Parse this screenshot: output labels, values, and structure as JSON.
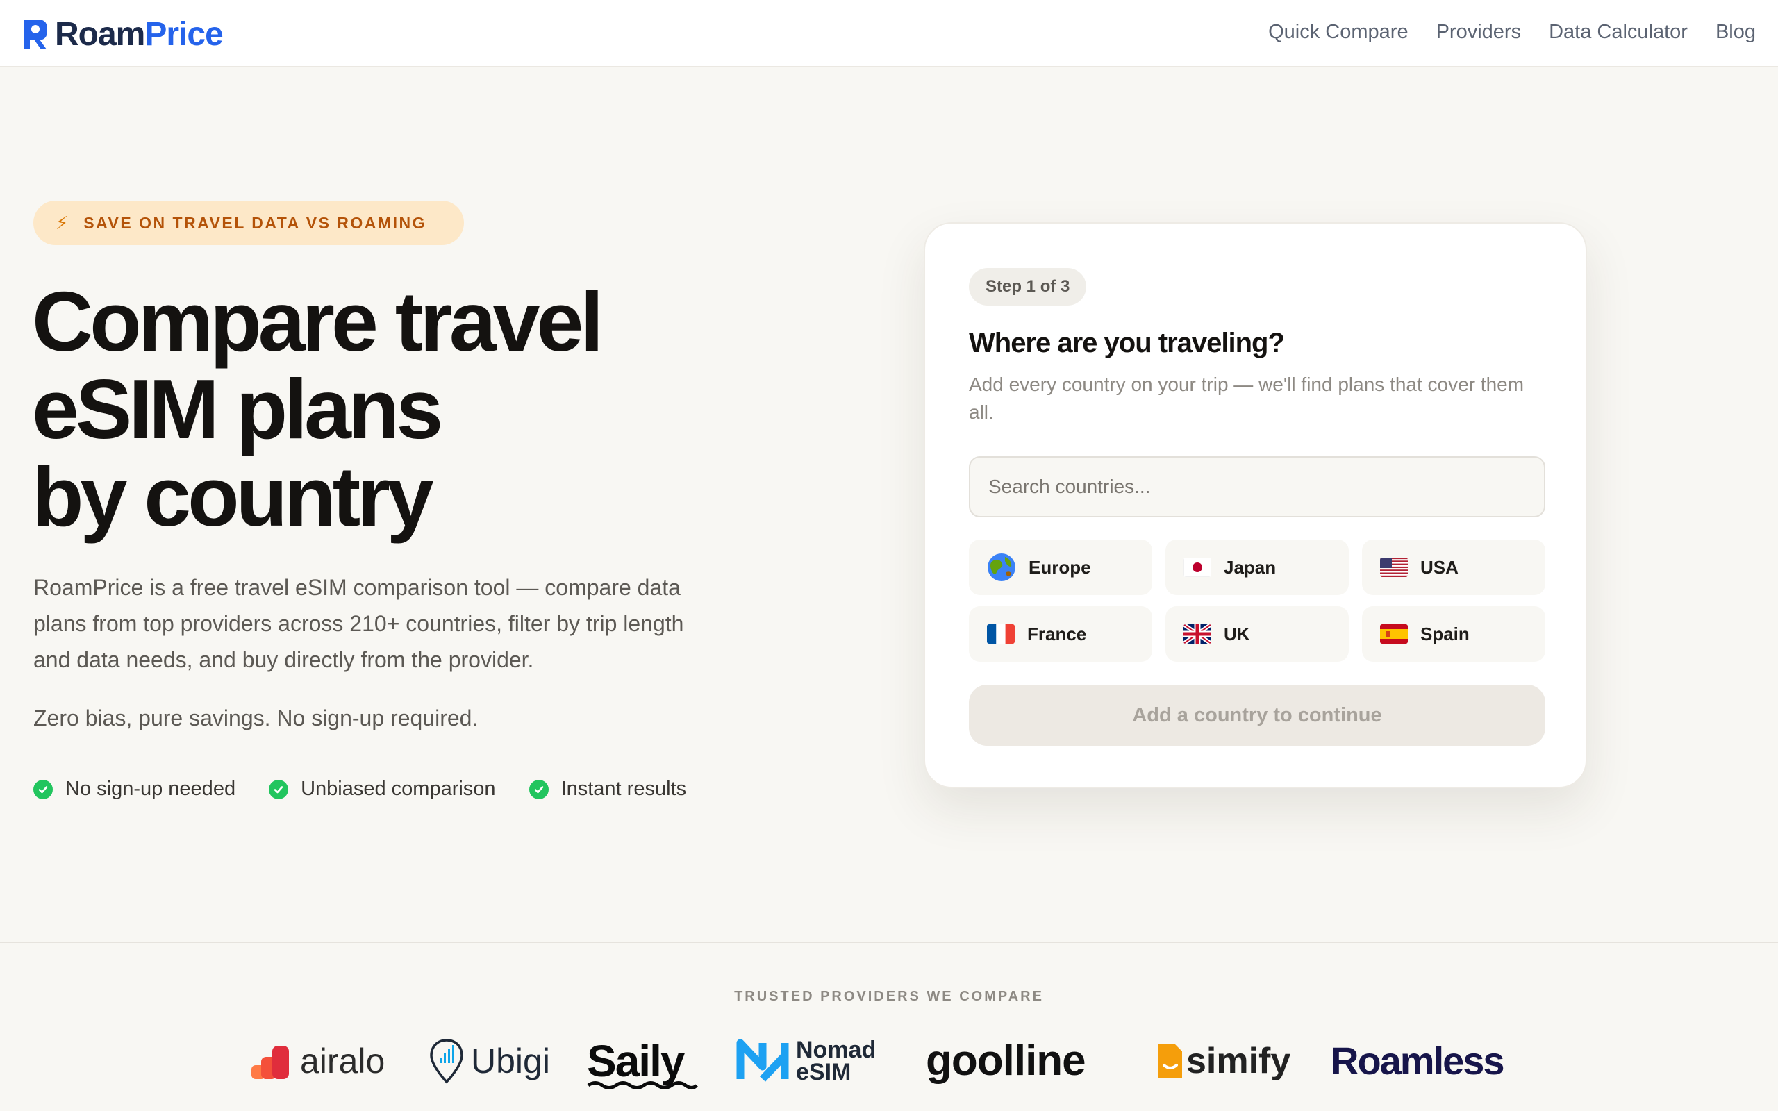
{
  "brand": {
    "name_part1": "Roam",
    "name_part2": "Price"
  },
  "nav": {
    "items": [
      "Quick Compare",
      "Providers",
      "Data Calculator",
      "Blog"
    ]
  },
  "hero": {
    "badge": "SAVE ON TRAVEL DATA VS ROAMING",
    "title_lines": [
      "Compare travel",
      "eSIM plans",
      "by country"
    ],
    "description": "RoamPrice is a free travel eSIM comparison tool — compare data plans from top providers across 210+ countries, filter by trip length and data needs, and buy directly from the provider.",
    "subtext": "Zero bias, pure savings. No sign-up required.",
    "checks": [
      "No sign-up needed",
      "Unbiased comparison",
      "Instant results"
    ]
  },
  "card": {
    "step": "Step 1 of 3",
    "title": "Where are you traveling?",
    "description": "Add every country on your trip — we'll find plans that cover them all.",
    "search_placeholder": "Search countries...",
    "countries": [
      {
        "label": "Europe",
        "icon": "globe-icon"
      },
      {
        "label": "Japan",
        "icon": "japan-flag-icon"
      },
      {
        "label": "USA",
        "icon": "usa-flag-icon"
      },
      {
        "label": "France",
        "icon": "france-flag-icon"
      },
      {
        "label": "UK",
        "icon": "uk-flag-icon"
      },
      {
        "label": "Spain",
        "icon": "spain-flag-icon"
      }
    ],
    "cta": "Add a country to continue"
  },
  "providers": {
    "label": "TRUSTED PROVIDERS WE COMPARE",
    "items": [
      "airalo",
      "Ubigi",
      "Saily",
      "Nomad eSIM",
      "goolline",
      "simify",
      "Roamless"
    ]
  },
  "colors": {
    "accent": "#2563eb",
    "badge_bg": "#fde8c8",
    "badge_text": "#b45309",
    "check": "#22c55e"
  }
}
